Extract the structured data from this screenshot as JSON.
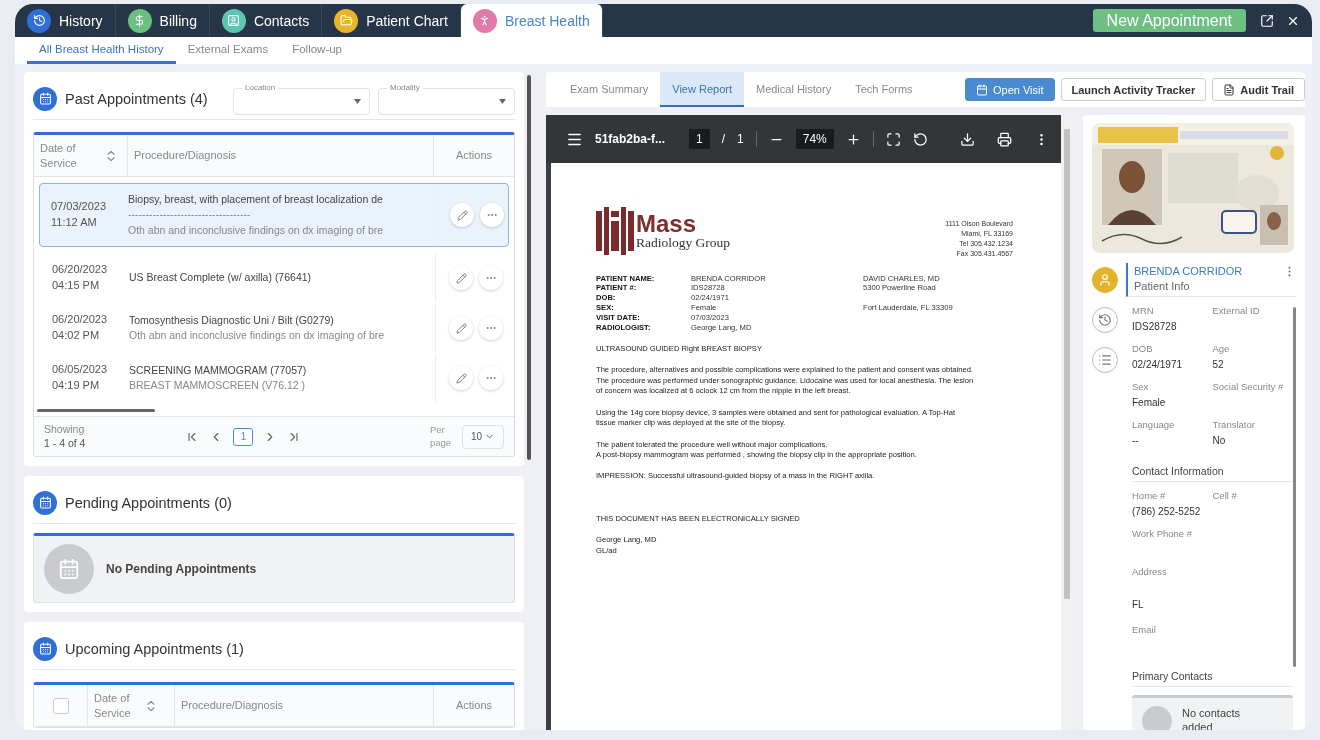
{
  "top_tabs": [
    {
      "label": "History",
      "kind": "history",
      "color": "#2f6fd6",
      "selected": false
    },
    {
      "label": "Billing",
      "kind": "billing",
      "color": "#6cbf7e",
      "selected": false
    },
    {
      "label": "Contacts",
      "kind": "contacts",
      "color": "#5cc6b0",
      "selected": false
    },
    {
      "label": "Patient Chart",
      "kind": "chart",
      "color": "#e6b52a",
      "selected": false
    },
    {
      "label": "Breast Health",
      "kind": "breast",
      "color": "#e07aa8",
      "selected": true
    }
  ],
  "new_appointment": "New Appointment",
  "sub_tabs": [
    {
      "label": "All Breast Health History",
      "selected": true
    },
    {
      "label": "External Exams",
      "selected": false
    },
    {
      "label": "Follow-up",
      "selected": false
    }
  ],
  "past_appointments": {
    "title": "Past Appointments (4)",
    "filters": [
      {
        "label": "Location"
      },
      {
        "label": "Modality"
      }
    ],
    "columns": [
      "Date of Service",
      "Procedure/Diagnosis",
      "Actions"
    ],
    "rows": [
      {
        "date": "07/03/2023",
        "time": "11:12 AM",
        "procedure": "Biopsy, breast, with placement of breast localization de",
        "separator": "-----------------------------------",
        "diagnosis": "Oth abn and inconclusive findings on dx imaging of bre",
        "selected": true
      },
      {
        "date": "06/20/2023",
        "time": "04:15 PM",
        "procedure": "US Breast Complete (w/ axilla) (76641)",
        "selected": false
      },
      {
        "date": "06/20/2023",
        "time": "04:02 PM",
        "procedure": "Tomosynthesis Diagnostic Uni / Bilt (G0279)",
        "diagnosis": "Oth abn and inconclusive findings on dx imaging of bre",
        "selected": false
      },
      {
        "date": "06/05/2023",
        "time": "04:19 PM",
        "procedure": "SCREENING MAMMOGRAM (77057)",
        "diagnosis": "BREAST MAMMOSCREEN (V76.12 )",
        "selected": false
      }
    ],
    "showing_label": "Showing",
    "showing_range": "1 - 4 of 4",
    "page": "1",
    "per_page_label": "Per page",
    "per_page": "10"
  },
  "pending_appointments": {
    "title": "Pending Appointments (0)",
    "empty_text": "No Pending Appointments"
  },
  "upcoming_appointments": {
    "title": "Upcoming Appointments (1)",
    "select_all_checked": false,
    "columns": [
      "Date of Service",
      "Procedure/Diagnosis",
      "Actions"
    ]
  },
  "report_tabs": [
    {
      "label": "Exam Summary",
      "selected": false
    },
    {
      "label": "View Report",
      "selected": true
    },
    {
      "label": "Medical History",
      "selected": false
    },
    {
      "label": "Tech Forms",
      "selected": false
    }
  ],
  "report_actions": [
    {
      "label": "Open Visit",
      "kind": "primary"
    },
    {
      "label": "Launch Activity Tracker",
      "kind": "outline"
    },
    {
      "label": "Audit Trail",
      "kind": "outline-doc"
    }
  ],
  "pdf_viewer": {
    "file_name": "51fab2ba-f...",
    "page": "1",
    "page_separator": "/",
    "page_count": "1",
    "zoom": "74%"
  },
  "report": {
    "logo_word": "Mass",
    "logo_subtitle": "Radiology Group",
    "address": [
      "1111 Olson Boulevard",
      "Miami, FL 33169",
      "Tel 305.432.1234",
      "Fax 305.431.4567"
    ],
    "fields": [
      {
        "label": "PATIENT NAME:",
        "value": "BRENDA CORRIDOR"
      },
      {
        "label": "PATIENT #:",
        "value": "IDS28728"
      },
      {
        "label": "DOB:",
        "value": "02/24/1971"
      },
      {
        "label": "SEX:",
        "value": "Female"
      },
      {
        "label": "VISIT DATE:",
        "value": "07/03/2023"
      },
      {
        "label": "RADIOLOGIST:",
        "value": "George Lang, MD"
      }
    ],
    "referrer_name": "DAVID CHARLES,  MD",
    "referrer_street": "5300 Powerline Road",
    "referrer_city": "Fort Lauderdale, FL 33309",
    "heading": "ULTRASOUND GUIDED Right BREAST BIOPSY",
    "paragraphs": [
      [
        "The procedure, alternatives and possible complications were explained to the patient and consent was obtained.",
        "The procedure was performed under sonographic guidance. Lidocaine was used for local anesthesia. The lesion",
        "of concern was localized at 6 oclock 12 cm from the nipple in the left breast."
      ],
      [
        "Using the 14g core biopsy device, 3 samples were obtained and sent for pathological evaluation. A Top-Hat",
        "tissue marker clip was deployed at the site of the biopsy."
      ],
      [
        "The patient tolerated the procedure well without major complications.",
        "A post-biopsy mammogram was performed , showing the biopsy clip in the appropriate position."
      ],
      [
        "IMPRESSION: Successful ultrasound-guided biopsy of a mass in the RIGHT axilla."
      ]
    ],
    "signed": "THIS DOCUMENT HAS BEEN ELECTRONICALLY SIGNED",
    "signer": "George Lang, MD",
    "initials": "GL/ad"
  },
  "patient_panel": {
    "nav": [
      {
        "kind": "user",
        "selected": true
      },
      {
        "kind": "history",
        "selected": false
      },
      {
        "kind": "checklist",
        "selected": false
      }
    ],
    "name": "BRENDA CORRIDOR",
    "subtitle": "Patient Info",
    "details": [
      {
        "label": "MRN",
        "value": "IDS28728"
      },
      {
        "label": "External ID"
      },
      {
        "label": "DOB",
        "value": "02/24/1971"
      },
      {
        "label": "Age",
        "value": "52"
      },
      {
        "label": "Sex",
        "value": "Female"
      },
      {
        "label": "Social Security #"
      },
      {
        "label": "Language",
        "value": "--"
      },
      {
        "label": "Translator",
        "value": "No"
      }
    ],
    "contact_title": "Contact Information",
    "contact": [
      {
        "label": "Home #",
        "value": "(786) 252-5252"
      },
      {
        "label": "Cell #"
      },
      {
        "label": "Work Phone #"
      },
      {
        "label": "Address",
        "value": "FL"
      },
      {
        "label": "Email"
      }
    ],
    "primary_contacts_title": "Primary Contacts",
    "no_contacts": "No contacts added"
  }
}
